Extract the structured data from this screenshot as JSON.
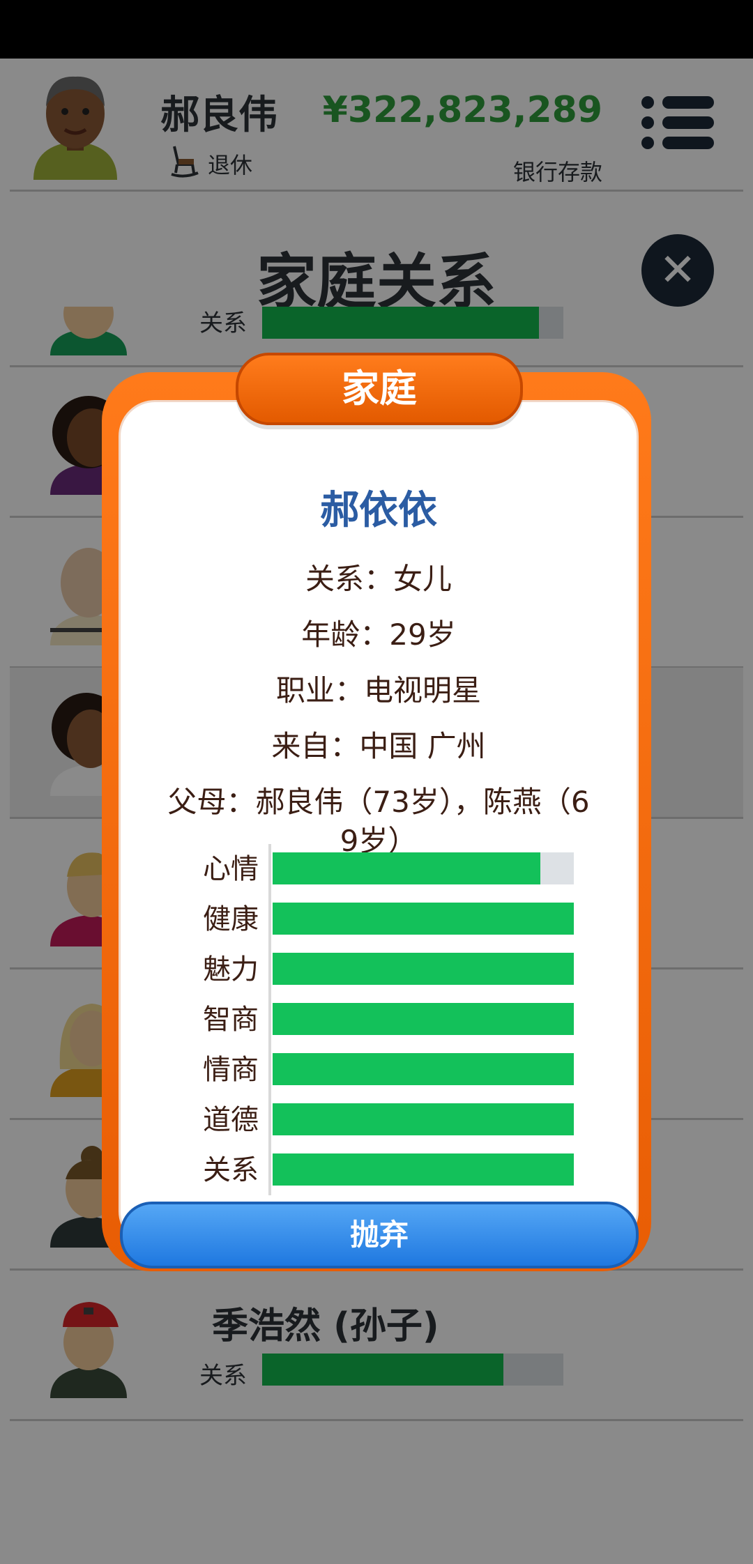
{
  "header": {
    "name": "郝良伟",
    "status": "退休",
    "money": "¥322,823,289",
    "money_label": "银行存款"
  },
  "page": {
    "title": "家庭关系"
  },
  "list": {
    "partial_row_label": "关系",
    "partial_row_level": 0.92,
    "last_row": {
      "name": "季浩然 (孙子)",
      "label": "关系",
      "level": 0.8
    }
  },
  "modal": {
    "tab_label": "家庭",
    "person_name": "郝依依",
    "lines": [
      "关系：女儿",
      "年龄：29岁",
      "职业：电视明星",
      "来自：中国 广州",
      "父母：郝良伟（73岁），陈燕（6 9岁）"
    ],
    "stats": [
      {
        "label": "心情",
        "level": 0.89
      },
      {
        "label": "健康",
        "level": 1.0
      },
      {
        "label": "魅力",
        "level": 1.0
      },
      {
        "label": "智商",
        "level": 1.0
      },
      {
        "label": "情商",
        "level": 1.0
      },
      {
        "label": "道德",
        "level": 1.0
      },
      {
        "label": "关系",
        "level": 1.0
      }
    ],
    "button_label": "抛弃"
  },
  "colors": {
    "accent_orange": "#e85d04",
    "bar_green": "#13c15a",
    "money_green": "#2f9d3c",
    "name_blue": "#2b5ca3",
    "button_blue": "#1f78e0"
  }
}
